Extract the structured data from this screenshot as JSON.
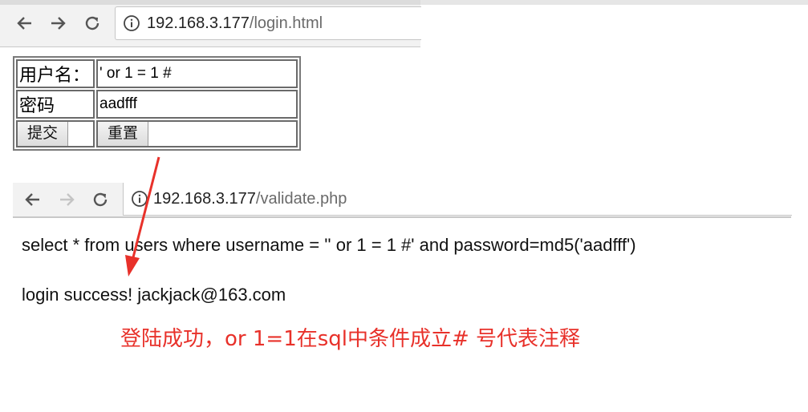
{
  "browser1": {
    "url_host": "192.168.3.177",
    "url_path": "/login.html"
  },
  "form": {
    "username_label": "用户名：",
    "username_value": "' or 1 = 1 #",
    "password_label": "密码",
    "password_value": "aadfff",
    "submit_label": "提交",
    "reset_label": "重置"
  },
  "browser2": {
    "url_host": "192.168.3.177",
    "url_path": "/validate.php"
  },
  "page": {
    "sql_line": "select * from users where username = '' or 1 = 1 #' and password=md5('aadfff')",
    "result_line": "login success! jackjack@163.com"
  },
  "annotation": {
    "text": "登陆成功，or 1=1在sql中条件成立# 号代表注释",
    "color": "#e8312a"
  },
  "icons": [
    "back-arrow-icon",
    "forward-arrow-icon",
    "reload-icon",
    "info-icon"
  ]
}
